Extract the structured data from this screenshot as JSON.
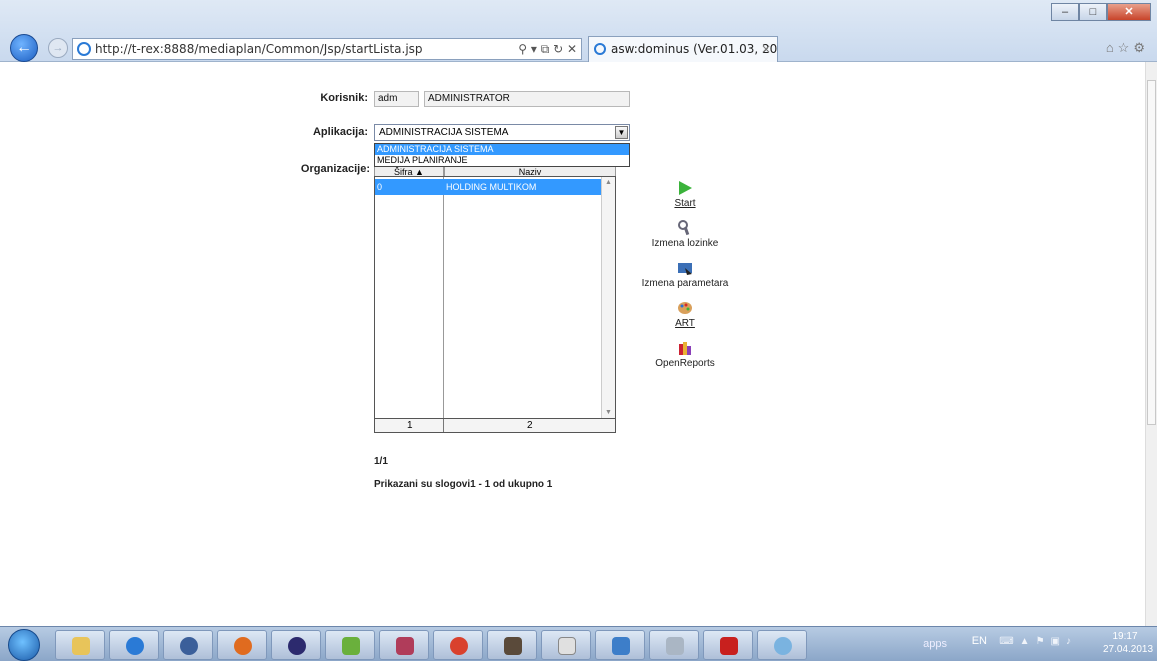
{
  "browser": {
    "address": "http://t-rex:8888/mediaplan/Common/Jsp/startLista.jsp",
    "tab_title": "asw:dominus (Ver.01.03, 20...",
    "tab_close": "×"
  },
  "form": {
    "korisnik_label": "Korisnik:",
    "korisnik_code": "adm",
    "korisnik_name": "ADMINISTRATOR",
    "aplikacija_label": "Aplikacija:",
    "aplikacija_value": "ADMINISTRACIJA SISTEMA",
    "aplikacija_options": [
      "ADMINISTRACIJA SISTEMA",
      "MEDIJA PLANIRANJE"
    ],
    "organizacije_label": "Organizacije:"
  },
  "grid": {
    "columns": [
      "Šifra ▲",
      "Naziv"
    ],
    "rows": [
      {
        "sifra": "0",
        "naziv": "HOLDING MULTIKOM"
      }
    ],
    "footer": [
      "1",
      "2"
    ]
  },
  "actions": [
    {
      "label": "Start",
      "icon": "play-icon"
    },
    {
      "label": "Izmena lozinke",
      "icon": "key-icon"
    },
    {
      "label": "Izmena parametara",
      "icon": "settings-icon"
    },
    {
      "label": "ART",
      "icon": "palette-icon"
    },
    {
      "label": "OpenReports",
      "icon": "reports-icon"
    }
  ],
  "paging": {
    "page": "1/1",
    "summary": "Prikazani su slogovi1 - 1 od ukupno 1"
  },
  "taskbar": {
    "apps_label": "apps",
    "language": "EN",
    "time": "19:17",
    "date": "27.04.2013"
  },
  "colors": {
    "selection": "#3399ff",
    "start_green": "#3bb33b"
  }
}
